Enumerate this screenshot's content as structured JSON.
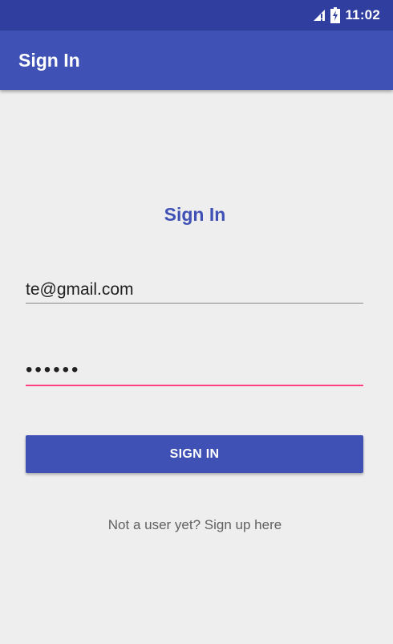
{
  "status_bar": {
    "time": "11:02",
    "icons": [
      "signal-icon",
      "battery-charging-icon"
    ]
  },
  "app_bar": {
    "title": "Sign In"
  },
  "form": {
    "heading": "Sign In",
    "email_value": "te@gmail.com",
    "password_value": "••••••",
    "submit_label": "SIGN IN",
    "signup_text": "Not a user yet? Sign up here"
  },
  "colors": {
    "primary": "#3f51b5",
    "primary_dark": "#303f9f",
    "accent": "#ff4081",
    "background": "#eeeeee"
  }
}
